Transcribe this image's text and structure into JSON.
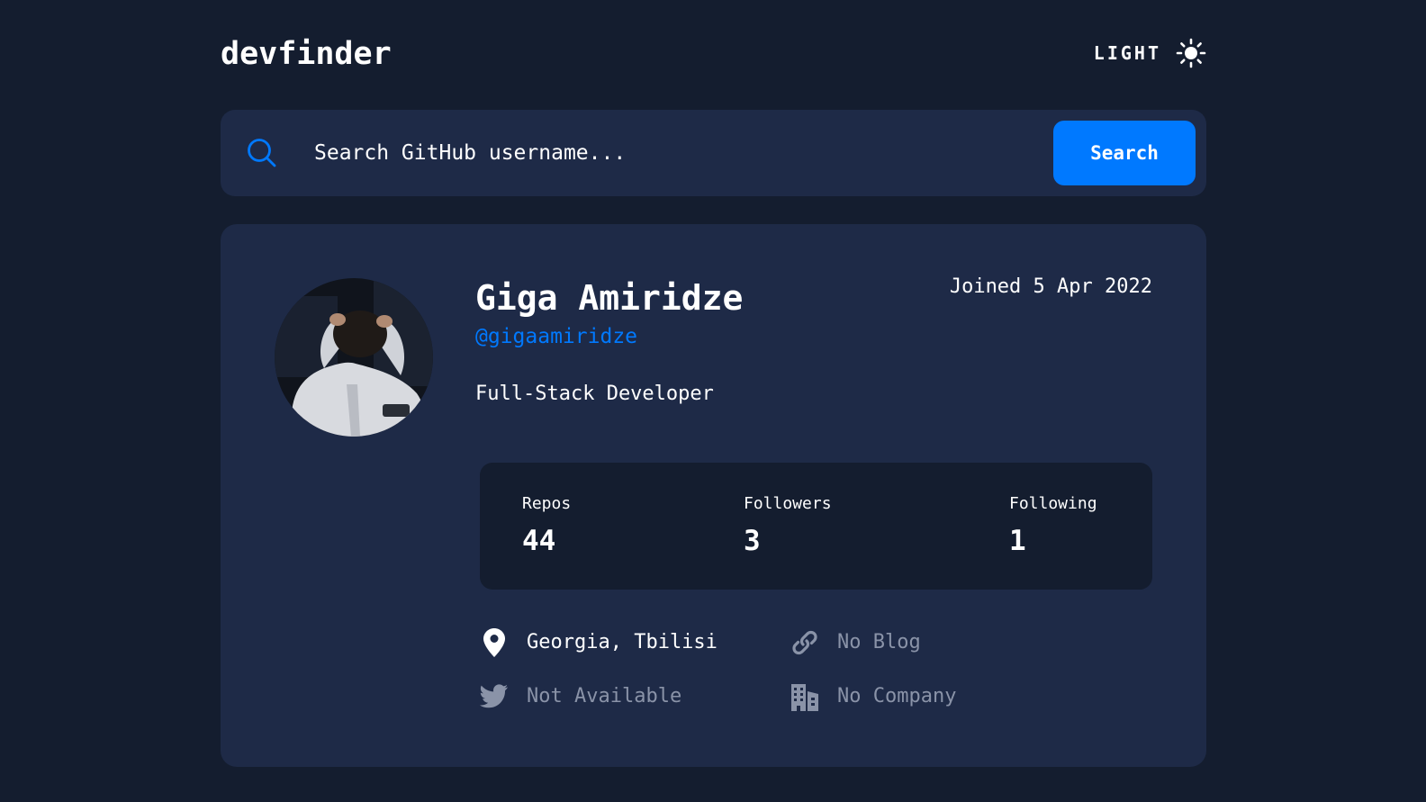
{
  "app": {
    "logo": "devfinder",
    "theme_toggle_label": "LIGHT",
    "theme_icon": "sun-icon"
  },
  "search": {
    "placeholder": "Search GitHub username...",
    "value": "",
    "button_label": "Search",
    "icon": "search-icon"
  },
  "profile": {
    "name": "Giga Amiridze",
    "login": "@gigaamiridze",
    "joined": "Joined 5 Apr 2022",
    "bio": "Full-Stack Developer",
    "stats": {
      "repos_label": "Repos",
      "repos_value": "44",
      "followers_label": "Followers",
      "followers_value": "3",
      "following_label": "Following",
      "following_value": "1"
    },
    "links": {
      "location": "Georgia, Tbilisi",
      "blog": "No Blog",
      "twitter": "Not Available",
      "company": "No Company"
    }
  },
  "colors": {
    "background": "#141d2f",
    "card": "#1e2a47",
    "accent": "#0079ff",
    "muted_text": "#8a93a8",
    "text": "#ffffff"
  }
}
